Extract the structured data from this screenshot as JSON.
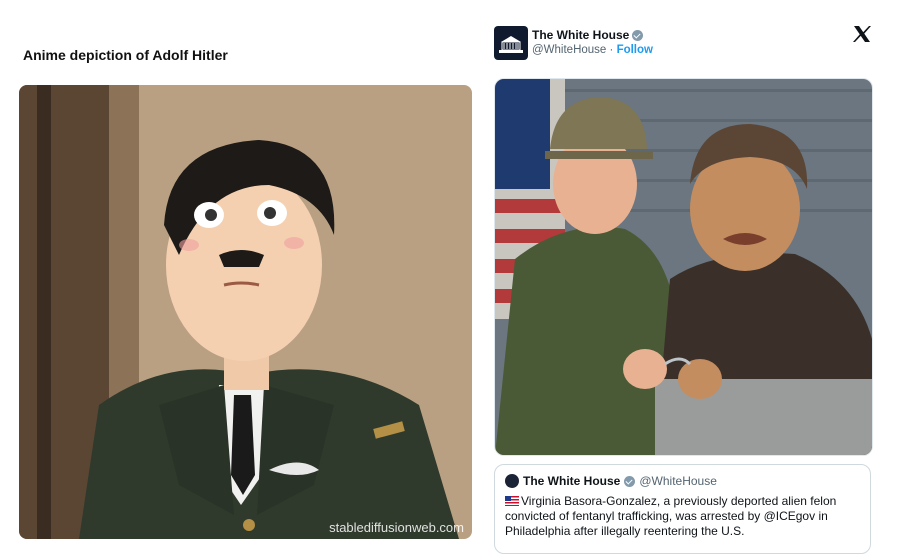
{
  "left": {
    "title": "Anime depiction of Adolf Hitler",
    "watermark": "stablediffusionweb.com"
  },
  "tweet": {
    "name": "The White House",
    "handle": "@WhiteHouse",
    "separator": "·",
    "follow_label": "Follow",
    "x_icon": "x-logo-icon"
  },
  "quote": {
    "name": "The White House",
    "handle": "@WhiteHouse",
    "text": "Virginia Basora-Gonzalez, a previously deported alien felon convicted of fentanyl trafficking, was arrested by @ICEgov in Philadelphia after illegally reentering the U.S."
  },
  "colors": {
    "follow": "#1d9bf0",
    "verified": "#829aab"
  }
}
